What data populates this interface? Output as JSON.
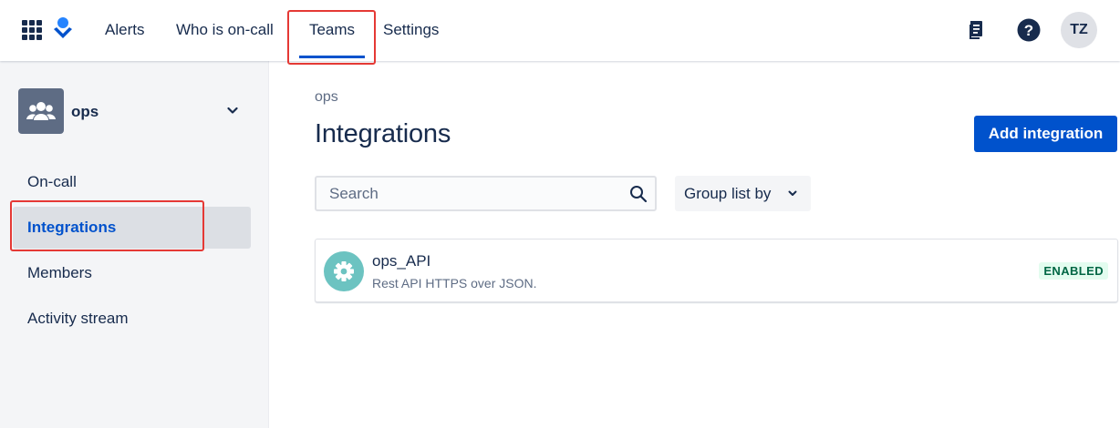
{
  "topnav": {
    "items": [
      {
        "label": "Alerts"
      },
      {
        "label": "Who is on-call"
      },
      {
        "label": "Teams"
      },
      {
        "label": "Settings"
      }
    ],
    "active": "Teams",
    "avatar_initials": "TZ",
    "icons": [
      "app-switcher-icon",
      "product-logo-icon",
      "docs-icon",
      "help-icon"
    ]
  },
  "sidebar": {
    "team_name": "ops",
    "items": [
      {
        "label": "On-call"
      },
      {
        "label": "Integrations"
      },
      {
        "label": "Members"
      },
      {
        "label": "Activity stream"
      }
    ],
    "active": "Integrations"
  },
  "main": {
    "breadcrumb": "ops",
    "title": "Integrations",
    "add_button_label": "Add integration",
    "search_placeholder": "Search",
    "group_by_label": "Group list by",
    "integrations": [
      {
        "name": "ops_API",
        "description": "Rest API HTTPS over JSON.",
        "status": "ENABLED"
      }
    ]
  },
  "colors": {
    "accent": "#0052cc",
    "highlight_box": "#e53935",
    "enabled_badge_bg": "#e3fcef",
    "enabled_badge_text": "#006644",
    "integration_icon_bg": "#6cc3c1"
  }
}
